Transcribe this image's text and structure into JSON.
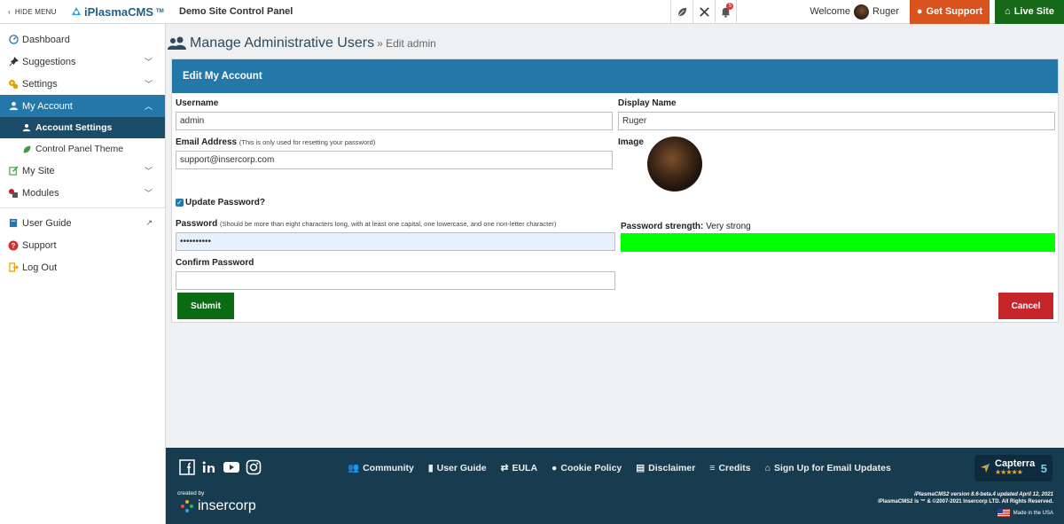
{
  "topbar": {
    "hide_menu": "HIDE MENU",
    "brand": "iPlasmaCMS",
    "brand_tm": "TM",
    "site_title": "Demo Site Control Panel",
    "notification_count": "5",
    "welcome_label": "Welcome",
    "username": "Ruger",
    "support_button": "Get Support",
    "live_site_button": "Live Site"
  },
  "sidebar": {
    "items": [
      {
        "label": "Dashboard"
      },
      {
        "label": "Suggestions"
      },
      {
        "label": "Settings"
      },
      {
        "label": "My Account"
      },
      {
        "label": "Account Settings"
      },
      {
        "label": "Control Panel Theme"
      },
      {
        "label": "My Site"
      },
      {
        "label": "Modules"
      },
      {
        "label": "User Guide"
      },
      {
        "label": "Support"
      },
      {
        "label": "Log Out"
      }
    ]
  },
  "page": {
    "title": "Manage Administrative Users",
    "breadcrumb": "» Edit admin"
  },
  "form": {
    "header": "Edit My Account",
    "username_label": "Username",
    "username_value": "admin",
    "display_name_label": "Display Name",
    "display_name_value": "Ruger",
    "email_label": "Email Address",
    "email_hint": "(This is only used for resetting your password)",
    "email_value": "support@insercorp.com",
    "image_label": "Image",
    "update_password_label": "Update Password?",
    "password_label": "Password",
    "password_hint": "(Should be more than eight characters long, with at least one capital, one lowercase, and one non-letter character)",
    "password_value": "••••••••••",
    "strength_label": "Password strength:",
    "strength_value": "Very strong",
    "strength_level": 1.0,
    "confirm_label": "Confirm Password",
    "confirm_value": "",
    "submit_button": "Submit",
    "cancel_button": "Cancel"
  },
  "footer": {
    "links": [
      {
        "label": "Community"
      },
      {
        "label": "User Guide"
      },
      {
        "label": "EULA"
      },
      {
        "label": "Cookie Policy"
      },
      {
        "label": "Disclaimer"
      },
      {
        "label": "Credits"
      },
      {
        "label": "Sign Up for Email Updates"
      }
    ],
    "created_by": "created by",
    "company": "insercorp",
    "capterra_name": "Capterra",
    "capterra_stars": "★★★★★",
    "capterra_score": "5",
    "version_text": "iPlasmaCMS2 version 8.6-beta.4 updated April 12, 2021",
    "copyright_text": "iPlasmaCMS2 is ™ & ©2007-2021 Insercorp LTD. All Rights Reserved.",
    "made_in": "Made in the USA"
  },
  "colors": {
    "primary": "#2377a9",
    "sidebar_sub_active": "#1b4d6b",
    "support_orange": "#d9531e",
    "live_green": "#156917",
    "submit_green": "#0b6b12",
    "cancel_red": "#c5262b",
    "strength_green": "#00ff00",
    "footer_bg": "#173b4f"
  }
}
